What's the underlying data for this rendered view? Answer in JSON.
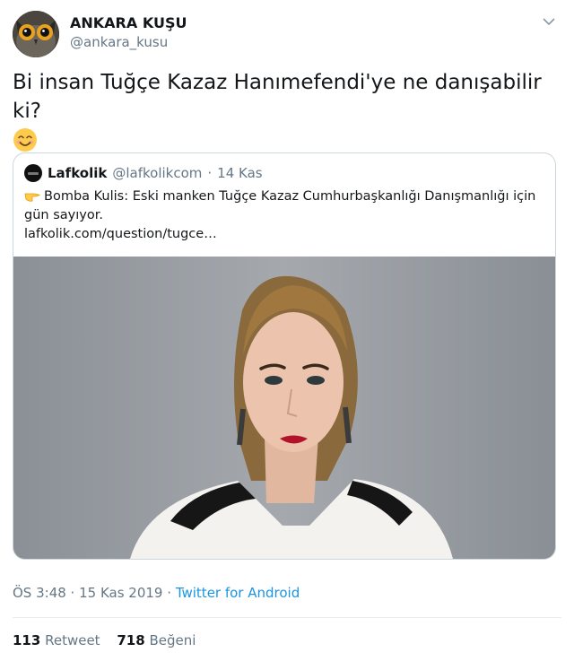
{
  "tweet": {
    "author_name": "ANKARA KUŞU",
    "author_handle": "@ankara_kusu",
    "text": "Bi insan Tuğçe Kazaz Hanımefendi'ye ne danışabilir ki?",
    "emoji": "smiling-face-with-smiling-eyes",
    "menu_icon": "chevron-down-icon",
    "timestamp": "ÖS 3:48 · 15 Kas 2019",
    "separator": "·",
    "source": "Twitter for Android",
    "retweets_count": "113",
    "retweets_label": "Retweet",
    "likes_count": "718",
    "likes_label": "Beğeni"
  },
  "quoted": {
    "name": "Lafkolik",
    "handle": "@lafkolikcom",
    "dot": "·",
    "date": "14 Kas",
    "emoji": "backhand-index-pointing-right",
    "text": "Bomba Kulis: Eski manken Tuğçe Kazaz Cumhurbaşkanlığı Danışmanlığı için gün sayıyor.",
    "link": "lafkolik.com/question/tugce…",
    "image": "portrait-photo"
  },
  "colors": {
    "text": "#14171a",
    "secondary": "#657786",
    "link": "#1b95e0",
    "border": "#ccd6dd"
  }
}
